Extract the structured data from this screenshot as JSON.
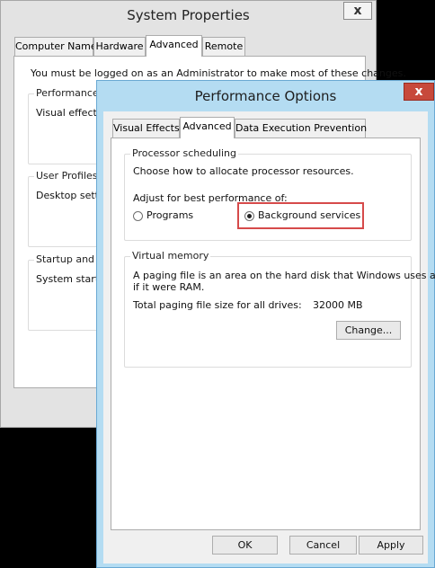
{
  "system_properties": {
    "title": "System Properties",
    "close_glyph": "x",
    "tabs": [
      "Computer Name",
      "Hardware",
      "Advanced",
      "Remote"
    ],
    "notice": "You must be logged on as an Administrator to make most of these changes.",
    "groups": {
      "performance": {
        "title": "Performance",
        "text": "Visual effects, p"
      },
      "user_profiles": {
        "title": "User Profiles",
        "text": "Desktop setting"
      },
      "startup": {
        "title": "Startup and Re",
        "text": "System startup"
      }
    }
  },
  "performance_options": {
    "title": "Performance Options",
    "close_glyph": "x",
    "tabs": [
      "Visual Effects",
      "Advanced",
      "Data Execution Prevention"
    ],
    "processor_scheduling": {
      "title": "Processor scheduling",
      "description": "Choose how to allocate processor resources.",
      "adjust_label": "Adjust for best performance of:",
      "options": [
        {
          "label": "Programs",
          "selected": false
        },
        {
          "label": "Background services",
          "selected": true
        }
      ]
    },
    "virtual_memory": {
      "title": "Virtual memory",
      "description_line1": "A paging file is an area on the hard disk that Windows uses as",
      "description_line2": "if it were RAM.",
      "total_label": "Total paging file size for all drives:",
      "total_value": "32000 MB",
      "change_button": "Change..."
    },
    "buttons": {
      "ok": "OK",
      "cancel": "Cancel",
      "apply": "Apply"
    }
  },
  "colors": {
    "highlight": "#d64a4a",
    "active_title_bar": "#b4dcf2",
    "close_active": "#c7493b"
  }
}
